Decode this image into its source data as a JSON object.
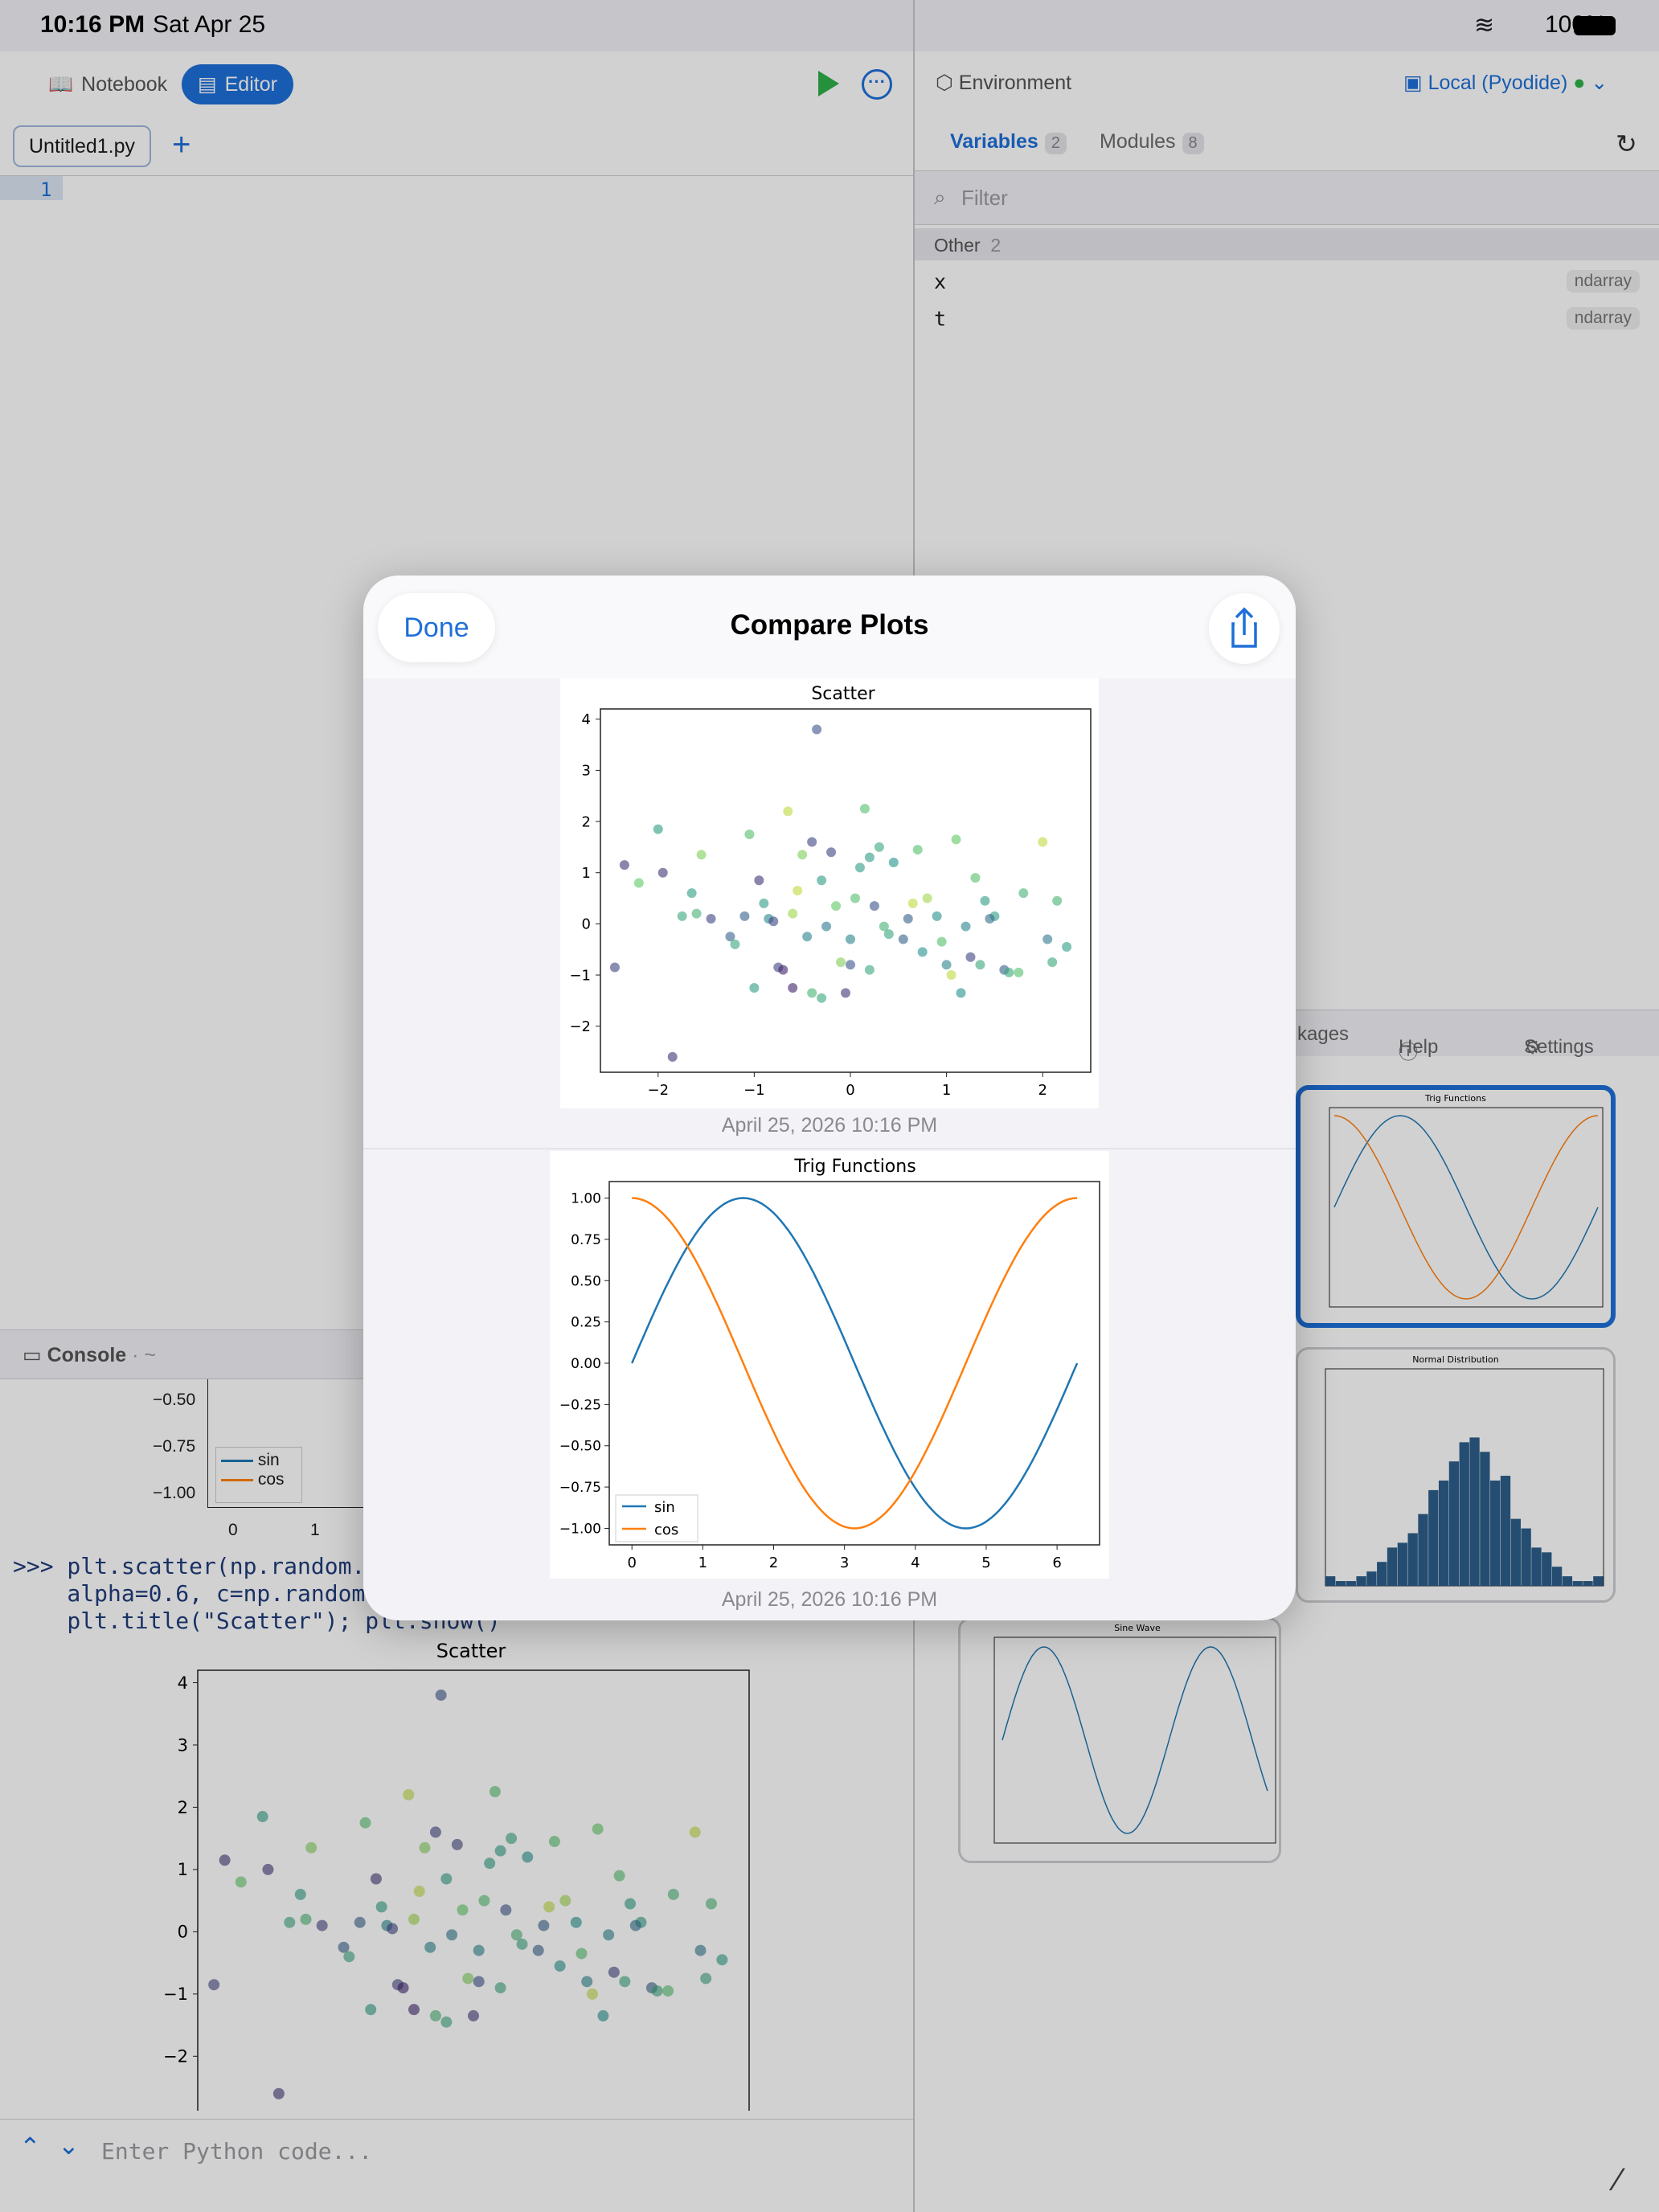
{
  "status": {
    "time": "10:16 PM",
    "date": "Sat Apr 25",
    "battery": "100%"
  },
  "toolbar": {
    "notebook_label": "Notebook",
    "editor_label": "Editor"
  },
  "editor": {
    "tab_name": "Untitled1.py",
    "line_number": "1"
  },
  "environment": {
    "title": "Environment",
    "runtime": "Local (Pyodide)",
    "tabs": {
      "variables": "Variables",
      "variables_count": "2",
      "modules": "Modules",
      "modules_count": "8"
    },
    "filter_placeholder": "Filter",
    "group": {
      "label": "Other",
      "count": "2"
    },
    "variables": [
      {
        "name": "x",
        "type": "ndarray"
      },
      {
        "name": "t",
        "type": "ndarray"
      }
    ]
  },
  "plots_panel": {
    "tab_packages": "kages",
    "tab_help": "Help",
    "tab_settings": "Settings",
    "thumbs": [
      "Trig Functions",
      "Normal Distribution",
      "Sine Wave"
    ]
  },
  "console": {
    "title": "Console",
    "path": "~",
    "legend": [
      "sin",
      "cos"
    ],
    "partial_ticks": [
      "−0.50",
      "−0.75",
      "−1.00"
    ],
    "partial_xticks": [
      "0",
      "1"
    ],
    "code_lines": [
      ">>> plt.scatter(np.random.",
      "    alpha=0.6, c=np.random",
      "    plt.title(\"Scatter\"); plt.show()"
    ],
    "input_placeholder": "Enter Python code..."
  },
  "modal": {
    "done_label": "Done",
    "title": "Compare Plots",
    "timestamps": [
      "April 25, 2026  10:16 PM",
      "April 25, 2026  10:16 PM"
    ]
  },
  "colors": {
    "accent": "#1e6fd9",
    "sin": "#1f77b4",
    "cos": "#ff7f0e",
    "run": "#2fb14a"
  },
  "chart_data": [
    {
      "type": "scatter",
      "title": "Scatter",
      "xlim": [
        -2.6,
        2.5
      ],
      "ylim": [
        -2.9,
        4.2
      ],
      "xticks": [
        -2,
        -1,
        0,
        1,
        2
      ],
      "yticks": [
        -2,
        -1,
        0,
        1,
        2,
        3,
        4
      ],
      "points": [
        [
          -2.45,
          -0.85,
          0.2
        ],
        [
          -2.35,
          1.15,
          0.15
        ],
        [
          -2.2,
          0.8,
          0.75
        ],
        [
          -2.0,
          1.85,
          0.55
        ],
        [
          -1.95,
          1.0,
          0.15
        ],
        [
          -1.85,
          -2.6,
          0.15
        ],
        [
          -1.75,
          0.15,
          0.6
        ],
        [
          -1.65,
          0.6,
          0.55
        ],
        [
          -1.6,
          0.2,
          0.65
        ],
        [
          -1.55,
          1.35,
          0.8
        ],
        [
          -1.45,
          0.1,
          0.2
        ],
        [
          -1.25,
          -0.25,
          0.3
        ],
        [
          -1.2,
          -0.4,
          0.6
        ],
        [
          -1.05,
          1.75,
          0.7
        ],
        [
          -1.0,
          -1.25,
          0.55
        ],
        [
          -0.95,
          0.85,
          0.15
        ],
        [
          -0.9,
          0.4,
          0.55
        ],
        [
          -0.85,
          0.1,
          0.45
        ],
        [
          -0.8,
          0.05,
          0.2
        ],
        [
          -0.75,
          -0.85,
          0.2
        ],
        [
          -0.7,
          -0.9,
          0.1
        ],
        [
          -0.65,
          2.2,
          0.9
        ],
        [
          -0.6,
          0.2,
          0.85
        ],
        [
          -0.55,
          0.65,
          0.9
        ],
        [
          -0.5,
          1.35,
          0.8
        ],
        [
          -0.45,
          -0.25,
          0.45
        ],
        [
          -0.4,
          -1.35,
          0.65
        ],
        [
          -0.4,
          1.6,
          0.2
        ],
        [
          -0.35,
          3.8,
          0.25
        ],
        [
          -0.3,
          0.85,
          0.55
        ],
        [
          -0.25,
          -0.05,
          0.4
        ],
        [
          -0.2,
          1.4,
          0.2
        ],
        [
          -0.15,
          0.35,
          0.75
        ],
        [
          -0.1,
          -0.75,
          0.8
        ],
        [
          -0.05,
          -1.35,
          0.15
        ],
        [
          0.0,
          -0.8,
          0.25
        ],
        [
          0.0,
          -0.3,
          0.45
        ],
        [
          0.05,
          0.5,
          0.7
        ],
        [
          0.1,
          1.1,
          0.55
        ],
        [
          0.15,
          2.25,
          0.7
        ],
        [
          0.2,
          1.3,
          0.55
        ],
        [
          0.25,
          0.35,
          0.25
        ],
        [
          0.3,
          1.5,
          0.6
        ],
        [
          0.35,
          -0.05,
          0.65
        ],
        [
          0.4,
          -0.2,
          0.6
        ],
        [
          0.45,
          1.2,
          0.5
        ],
        [
          0.55,
          -0.3,
          0.3
        ],
        [
          0.7,
          1.45,
          0.7
        ],
        [
          0.75,
          -0.55,
          0.5
        ],
        [
          0.8,
          0.5,
          0.85
        ],
        [
          0.9,
          0.15,
          0.5
        ],
        [
          0.95,
          -0.35,
          0.7
        ],
        [
          1.0,
          -0.8,
          0.45
        ],
        [
          1.05,
          -1.0,
          0.9
        ],
        [
          1.1,
          1.65,
          0.75
        ],
        [
          1.15,
          -1.35,
          0.5
        ],
        [
          1.2,
          -0.05,
          0.45
        ],
        [
          1.25,
          -0.65,
          0.2
        ],
        [
          1.3,
          0.9,
          0.7
        ],
        [
          1.35,
          -0.8,
          0.6
        ],
        [
          1.4,
          0.45,
          0.55
        ],
        [
          1.5,
          0.15,
          0.55
        ],
        [
          1.6,
          -0.9,
          0.3
        ],
        [
          1.65,
          -0.95,
          0.6
        ],
        [
          1.75,
          -0.95,
          0.7
        ],
        [
          1.8,
          0.6,
          0.65
        ],
        [
          2.0,
          1.6,
          0.9
        ],
        [
          2.05,
          -0.3,
          0.4
        ],
        [
          2.1,
          -0.75,
          0.6
        ],
        [
          2.15,
          0.45,
          0.65
        ],
        [
          2.25,
          -0.45,
          0.55
        ],
        [
          -0.6,
          -1.25,
          0.1
        ],
        [
          0.6,
          0.1,
          0.3
        ],
        [
          -1.1,
          0.15,
          0.3
        ],
        [
          0.2,
          -0.9,
          0.6
        ],
        [
          1.45,
          0.1,
          0.35
        ],
        [
          -0.3,
          -1.45,
          0.6
        ],
        [
          0.65,
          0.4,
          0.9
        ]
      ]
    },
    {
      "type": "line",
      "title": "Trig Functions",
      "xlim": [
        -0.32,
        6.6
      ],
      "ylim": [
        -1.1,
        1.1
      ],
      "xticks": [
        0,
        1,
        2,
        3,
        4,
        5,
        6
      ],
      "yticks": [
        "1.00",
        "0.75",
        "0.50",
        "0.25",
        "0.00",
        "−0.25",
        "−0.50",
        "−0.75",
        "−1.00"
      ],
      "series": [
        {
          "name": "sin",
          "fn": "sin",
          "domain": [
            0,
            6.283
          ]
        },
        {
          "name": "cos",
          "fn": "cos",
          "domain": [
            0,
            6.283
          ]
        }
      ]
    }
  ]
}
